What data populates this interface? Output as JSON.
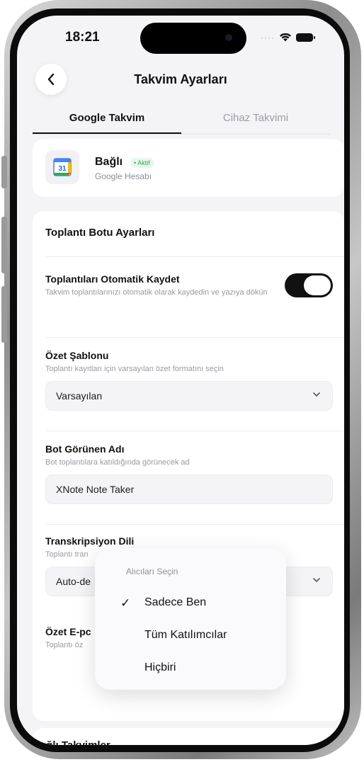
{
  "status_bar": {
    "time": "18:21"
  },
  "header": {
    "title": "Takvim Ayarları"
  },
  "tabs": [
    {
      "label": "Google Takvim",
      "active": true
    },
    {
      "label": "Cihaz Takvimi",
      "active": false
    }
  ],
  "account": {
    "icon_text": "31",
    "name": "Bağlı",
    "status": "• Aktif",
    "provider": "Google Hesabı"
  },
  "bot_settings": {
    "section_title": "Toplantı Botu Ayarları",
    "auto_record": {
      "label": "Toplantıları Otomatik Kaydet",
      "description": "Takvim toplantılarınızı otomatik olarak kaydedin ve yazıya dökün",
      "enabled": true
    },
    "summary_template": {
      "label": "Özet Şablonu",
      "description": "Toplantı kayıtları için varsayılan özet formatını seçin",
      "value": "Varsayılan"
    },
    "bot_name": {
      "label": "Bot Görünen Adı",
      "description": "Bot toplantılara katıldığında görünecek ad",
      "value": "XNote Note Taker"
    },
    "transcription_language": {
      "label": "Transkripsiyon Dili",
      "description": "Toplantı tran",
      "value": "Auto-de"
    },
    "summary_email": {
      "label": "Özet E-pc",
      "description": "Toplantı öz"
    }
  },
  "connected_calendars": {
    "title": "Bağlı Takvimler"
  },
  "recipient_menu": {
    "title": "Alıcıları Seçin",
    "options": [
      {
        "label": "Sadece Ben",
        "selected": true,
        "check": "✓"
      },
      {
        "label": "Tüm Katılımcılar",
        "selected": false,
        "check": ""
      },
      {
        "label": "Hiçbiri",
        "selected": false,
        "check": ""
      }
    ]
  },
  "colors": {
    "accent": "#111111",
    "active_badge": "#34a853",
    "screen_bg": "#f4f4f6"
  }
}
